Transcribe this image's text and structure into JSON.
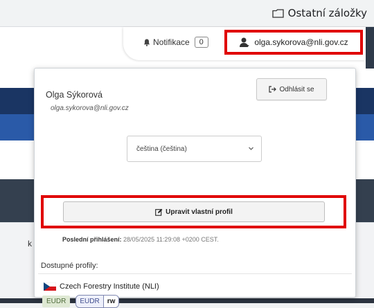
{
  "bookmarks_bar": {
    "other_bookmarks_label": "Ostatní záložky"
  },
  "header": {
    "notifications_label": "Notifikace",
    "notifications_count": "0",
    "user_email": "olga.sykorova@nli.gov.cz"
  },
  "page": {
    "edge_letter": "k"
  },
  "user_menu": {
    "name": "Olga Sýkorová",
    "email": "olga.sykorova@nli.gov.cz",
    "logout_label": "Odhlásit se",
    "language_selected": "čeština (čeština)",
    "edit_profile_label": "Upravit vlastní profil",
    "last_login_label": "Poslední přihlášení:",
    "last_login_value": "28/05/2025 11:29:08 +0200 CEST.",
    "available_profiles_label": "Dostupné profily:",
    "organization": "Czech Forestry Institute (NLI)",
    "badge_primary": "EUDR",
    "badge_group_name": "EUDR",
    "badge_group_role": "rw"
  },
  "colors": {
    "highlight": "#e00000",
    "nav_dark": "#1a3563",
    "nav_blue": "#2a5aa8"
  }
}
